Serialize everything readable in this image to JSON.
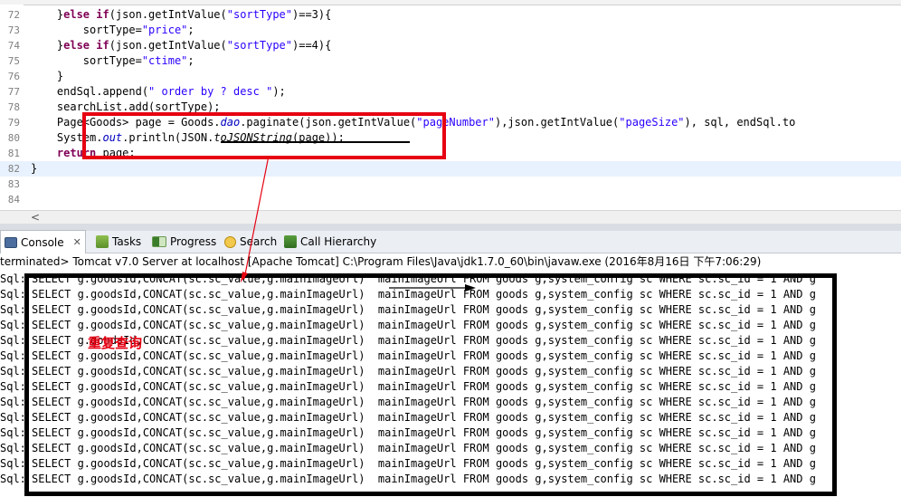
{
  "editor": {
    "lines": [
      {
        "n": "72",
        "segs": [
          [
            "",
            "    }"
          ],
          [
            "kw",
            "else if"
          ],
          [
            "",
            "(json.getIntValue("
          ],
          [
            "str",
            "\"sortType\""
          ],
          [
            "",
            ")==3){"
          ]
        ]
      },
      {
        "n": "73",
        "segs": [
          [
            "",
            "        sortType="
          ],
          [
            "str",
            "\"price\""
          ],
          [
            "",
            ";"
          ]
        ]
      },
      {
        "n": "74",
        "segs": [
          [
            "",
            "    }"
          ],
          [
            "kw",
            "else if"
          ],
          [
            "",
            "(json.getIntValue("
          ],
          [
            "str",
            "\"sortType\""
          ],
          [
            "",
            ")==4){"
          ]
        ]
      },
      {
        "n": "75",
        "segs": [
          [
            "",
            "        sortType="
          ],
          [
            "str",
            "\"ctime\""
          ],
          [
            "",
            ";"
          ]
        ]
      },
      {
        "n": "76",
        "segs": [
          [
            "",
            "    }"
          ]
        ]
      },
      {
        "n": "77",
        "segs": [
          [
            "",
            "    endSql.append("
          ],
          [
            "str",
            "\" order by ? desc \""
          ],
          [
            "",
            ");"
          ]
        ]
      },
      {
        "n": "78",
        "segs": [
          [
            "",
            "    searchList.add(sortType);"
          ]
        ]
      },
      {
        "n": "79",
        "segs": [
          [
            "",
            "    Page<Goods> page = Goods."
          ],
          [
            "fldi",
            "dao"
          ],
          [
            "",
            ".paginate(json.getIntValue("
          ],
          [
            "str",
            "\"pageNumber\""
          ],
          [
            "",
            "),json.getIntValue("
          ],
          [
            "str",
            "\"pageSize\""
          ],
          [
            "",
            "), sql, endSql.to"
          ]
        ]
      },
      {
        "n": "80",
        "segs": [
          [
            "",
            "    System."
          ],
          [
            "fldi",
            "out"
          ],
          [
            "",
            ".println(JSON."
          ],
          [
            "mi",
            "toJSONString"
          ],
          [
            "",
            "(page));"
          ]
        ]
      },
      {
        "n": "81",
        "segs": [
          [
            "",
            "    "
          ],
          [
            "kw",
            "return"
          ],
          [
            "",
            " page;"
          ]
        ]
      },
      {
        "n": "82",
        "segs": [
          [
            "",
            "}"
          ]
        ]
      },
      {
        "n": "83",
        "segs": []
      },
      {
        "n": "84",
        "segs": []
      }
    ],
    "scroll_left": "<"
  },
  "views": {
    "tabs": [
      {
        "label": "Console",
        "icon": "console-icon",
        "close": "✕"
      },
      {
        "label": "Tasks",
        "icon": "tasks-icon"
      },
      {
        "label": "Progress",
        "icon": "progress-icon"
      },
      {
        "label": "Search",
        "icon": "search-icon"
      },
      {
        "label": "Call Hierarchy",
        "icon": "hierarchy-icon"
      }
    ]
  },
  "console": {
    "status": "terminated> Tomcat v7.0 Server at localhost [Apache Tomcat] C:\\Program Files\\Java\\jdk1.7.0_60\\bin\\javaw.exe (2016年8月16日 下午7:06:29)",
    "prefix": "Sql:",
    "line": "SELECT g.goodsId,CONCAT(sc.sc_value,g.mainImageUrl)  mainImageUrl FROM goods g,system_config sc WHERE sc.sc_id = 1 AND g",
    "line_count": 14
  },
  "annotation": {
    "note": "重复查询",
    "red": "#e60012"
  }
}
